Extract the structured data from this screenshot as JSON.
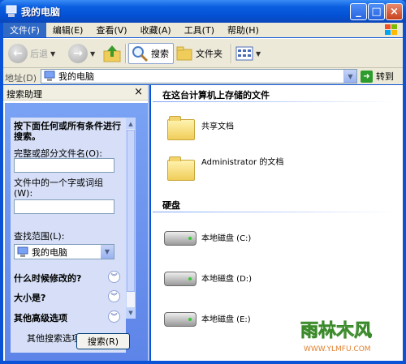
{
  "window": {
    "title": "我的电脑"
  },
  "menu": [
    "文件(F)",
    "编辑(E)",
    "查看(V)",
    "收藏(A)",
    "工具(T)",
    "帮助(H)"
  ],
  "toolbar": {
    "back": "后退",
    "search": "搜索",
    "folders": "文件夹"
  },
  "address": {
    "label": "地址(D)",
    "value": "我的电脑",
    "go": "转到"
  },
  "search_pane": {
    "header": "搜索助理",
    "close": "×",
    "instruction": "按下面任何或所有条件进行搜索。",
    "filename_label": "完整或部分文件名(O):",
    "phrase_label": "文件中的一个字或词组(W):",
    "scope_label": "查找范围(L):",
    "scope_value": "我的电脑",
    "when_modified": "什么时候修改的?",
    "size": "大小是?",
    "advanced": "其他高级选项",
    "more_options": "其他搜索选项(S)",
    "search_button": "搜索(R)"
  },
  "content": {
    "stored_header": "在这台计算机上存储的文件",
    "shared": "共享文档",
    "admin": "Administrator 的文档",
    "disks_header": "硬盘",
    "disk_c": "本地磁盘 (C:)",
    "disk_d": "本地磁盘 (D:)",
    "disk_e": "本地磁盘 (E:)"
  },
  "watermark": {
    "name": "雨林木风",
    "url": "WWW.YLMFU.COM"
  },
  "colors": {
    "titlebar": "#0450d4",
    "pane": "#d6dff7",
    "menubar": "#ece9d8"
  }
}
